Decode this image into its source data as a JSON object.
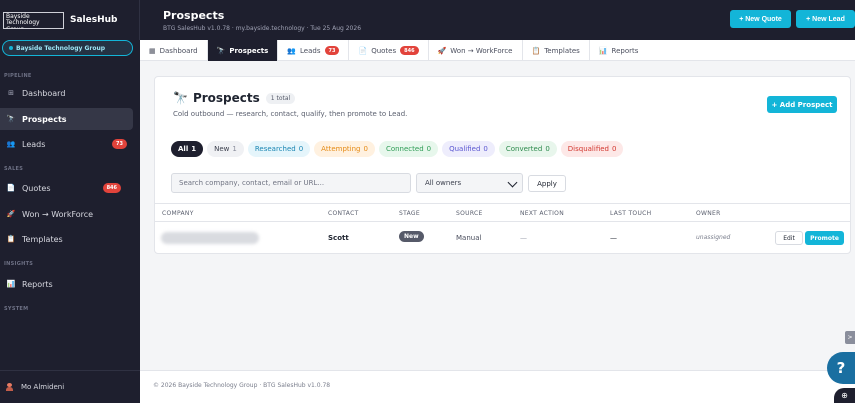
{
  "brand": {
    "logo_text": "Bayside Technology Group.",
    "app_name": "SalesHub"
  },
  "header": {
    "title": "Prospects",
    "subtitle": "BTG SalesHub v1.0.78 · my.bayside.technology · Tue 25 Aug 2026",
    "new_quote_label": "+ New Quote",
    "new_lead_label": "+ New Lead"
  },
  "sidebar": {
    "org_label": "Bayside Technology Group",
    "sections": {
      "pipeline": "PIPELINE",
      "sales": "SALES",
      "insights": "INSIGHTS",
      "system": "SYSTEM"
    },
    "items": [
      {
        "label": "Dashboard",
        "icon": "grid-icon"
      },
      {
        "label": "Prospects",
        "icon": "telescope-icon"
      },
      {
        "label": "Leads",
        "icon": "people-icon",
        "badge": "73"
      },
      {
        "label": "Quotes",
        "icon": "document-icon",
        "badge": "846"
      },
      {
        "label": "Won → WorkForce",
        "icon": "rocket-icon"
      },
      {
        "label": "Templates",
        "icon": "template-icon"
      },
      {
        "label": "Reports",
        "icon": "chart-icon"
      }
    ],
    "user_name": "Mo Almideni"
  },
  "tabs": [
    {
      "label": "Dashboard",
      "icon": "▦"
    },
    {
      "label": "Prospects",
      "icon": "🔭"
    },
    {
      "label": "Leads",
      "icon": "👥",
      "badge": "73"
    },
    {
      "label": "Quotes",
      "icon": "📄",
      "badge": "846"
    },
    {
      "label": "Won → WorkForce",
      "icon": "🚀"
    },
    {
      "label": "Templates",
      "icon": "📋"
    },
    {
      "label": "Reports",
      "icon": "📊"
    }
  ],
  "card": {
    "title": "Prospects",
    "count": "1 total",
    "description": "Cold outbound — research, contact, qualify, then promote to Lead.",
    "add_button": "+ Add Prospect"
  },
  "filters": [
    {
      "label": "All",
      "count": "1"
    },
    {
      "label": "New",
      "count": "1"
    },
    {
      "label": "Researched",
      "count": "0"
    },
    {
      "label": "Attempting",
      "count": "0"
    },
    {
      "label": "Connected",
      "count": "0"
    },
    {
      "label": "Qualified",
      "count": "0"
    },
    {
      "label": "Converted",
      "count": "0"
    },
    {
      "label": "Disqualified",
      "count": "0"
    }
  ],
  "search": {
    "placeholder": "Search company, contact, email or URL...",
    "owner_value": "All owners",
    "apply_label": "Apply"
  },
  "table": {
    "headers": [
      "COMPANY",
      "CONTACT",
      "STAGE",
      "SOURCE",
      "NEXT ACTION",
      "LAST TOUCH",
      "OWNER"
    ],
    "rows": [
      {
        "contact": "Scott",
        "stage": "New",
        "source": "Manual",
        "next_action": "—",
        "last_touch": "—",
        "owner": "unassigned",
        "edit_label": "Edit",
        "promote_label": "Promote"
      }
    ]
  },
  "footer": {
    "text": "© 2026 Bayside Technology Group · BTG SalesHub v1.0.78"
  },
  "widgets": {
    "collapse_arrow": ">",
    "help_label": "?",
    "corner_label": "⊕"
  },
  "colors": {
    "accent": "#13b5d8",
    "dark": "#1e1f2e",
    "badge": "#e2433b"
  }
}
